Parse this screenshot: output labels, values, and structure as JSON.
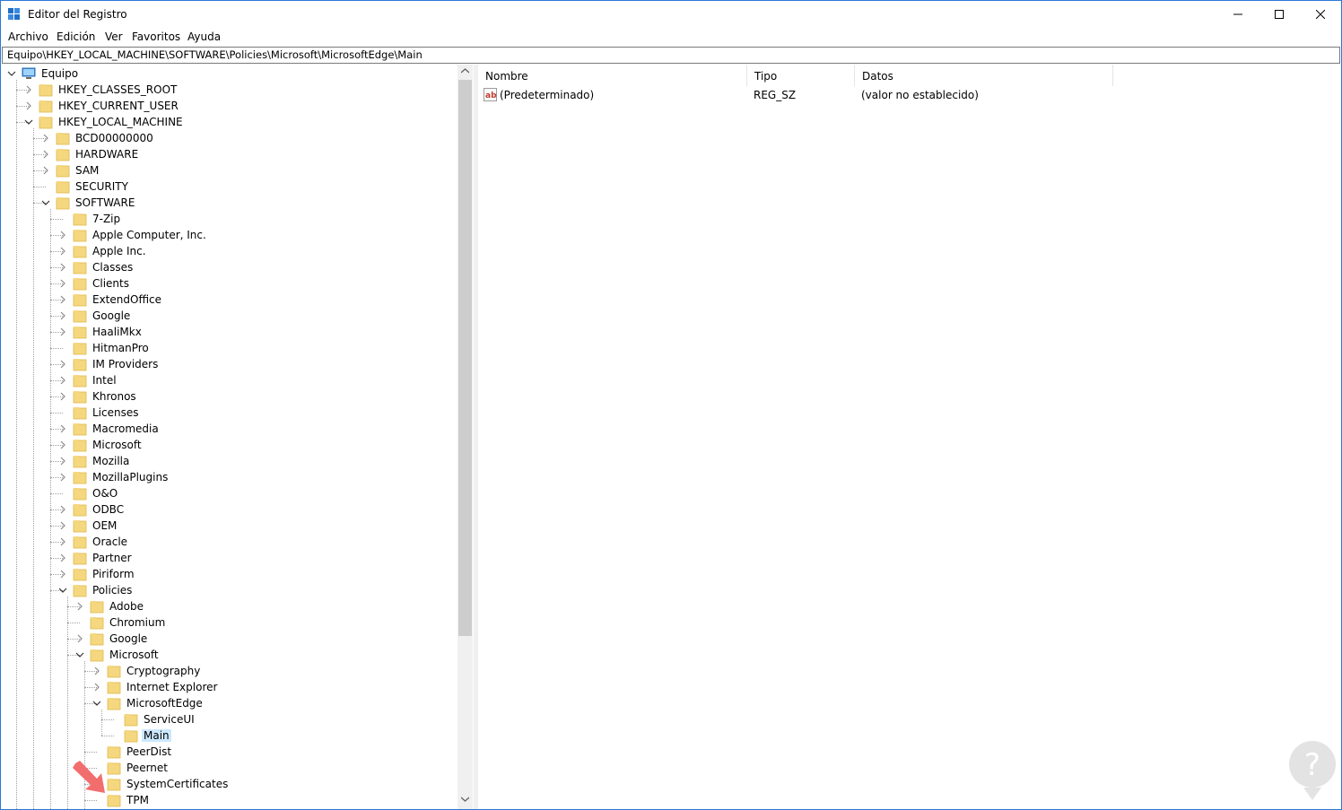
{
  "window": {
    "title": "Editor del Registro",
    "controls": [
      "minimize",
      "maximize",
      "close"
    ]
  },
  "menu": [
    "Archivo",
    "Edición",
    "Ver",
    "Favoritos",
    "Ayuda"
  ],
  "address": "Equipo\\HKEY_LOCAL_MACHINE\\SOFTWARE\\Policies\\Microsoft\\MicrosoftEdge\\Main",
  "tree": [
    {
      "label": "Equipo",
      "level": 0,
      "expander": "down",
      "icon": "computer-icon"
    },
    {
      "label": "HKEY_CLASSES_ROOT",
      "level": 1,
      "expander": "right"
    },
    {
      "label": "HKEY_CURRENT_USER",
      "level": 1,
      "expander": "right"
    },
    {
      "label": "HKEY_LOCAL_MACHINE",
      "level": 1,
      "expander": "down"
    },
    {
      "label": "BCD00000000",
      "level": 2,
      "expander": "right"
    },
    {
      "label": "HARDWARE",
      "level": 2,
      "expander": "right"
    },
    {
      "label": "SAM",
      "level": 2,
      "expander": "right"
    },
    {
      "label": "SECURITY",
      "level": 2,
      "expander": "none"
    },
    {
      "label": "SOFTWARE",
      "level": 2,
      "expander": "down"
    },
    {
      "label": "7-Zip",
      "level": 3,
      "expander": "none"
    },
    {
      "label": "Apple Computer, Inc.",
      "level": 3,
      "expander": "right"
    },
    {
      "label": "Apple Inc.",
      "level": 3,
      "expander": "right"
    },
    {
      "label": "Classes",
      "level": 3,
      "expander": "right"
    },
    {
      "label": "Clients",
      "level": 3,
      "expander": "right"
    },
    {
      "label": "ExtendOffice",
      "level": 3,
      "expander": "right"
    },
    {
      "label": "Google",
      "level": 3,
      "expander": "right"
    },
    {
      "label": "HaaliMkx",
      "level": 3,
      "expander": "right"
    },
    {
      "label": "HitmanPro",
      "level": 3,
      "expander": "none"
    },
    {
      "label": "IM Providers",
      "level": 3,
      "expander": "right"
    },
    {
      "label": "Intel",
      "level": 3,
      "expander": "right"
    },
    {
      "label": "Khronos",
      "level": 3,
      "expander": "right"
    },
    {
      "label": "Licenses",
      "level": 3,
      "expander": "none"
    },
    {
      "label": "Macromedia",
      "level": 3,
      "expander": "right"
    },
    {
      "label": "Microsoft",
      "level": 3,
      "expander": "right"
    },
    {
      "label": "Mozilla",
      "level": 3,
      "expander": "right"
    },
    {
      "label": "MozillaPlugins",
      "level": 3,
      "expander": "right"
    },
    {
      "label": "O&O",
      "level": 3,
      "expander": "none"
    },
    {
      "label": "ODBC",
      "level": 3,
      "expander": "right"
    },
    {
      "label": "OEM",
      "level": 3,
      "expander": "right"
    },
    {
      "label": "Oracle",
      "level": 3,
      "expander": "right"
    },
    {
      "label": "Partner",
      "level": 3,
      "expander": "right"
    },
    {
      "label": "Piriform",
      "level": 3,
      "expander": "right"
    },
    {
      "label": "Policies",
      "level": 3,
      "expander": "down"
    },
    {
      "label": "Adobe",
      "level": 4,
      "expander": "right"
    },
    {
      "label": "Chromium",
      "level": 4,
      "expander": "none"
    },
    {
      "label": "Google",
      "level": 4,
      "expander": "right"
    },
    {
      "label": "Microsoft",
      "level": 4,
      "expander": "down"
    },
    {
      "label": "Cryptography",
      "level": 5,
      "expander": "right"
    },
    {
      "label": "Internet Explorer",
      "level": 5,
      "expander": "right"
    },
    {
      "label": "MicrosoftEdge",
      "level": 5,
      "expander": "down"
    },
    {
      "label": "ServiceUI",
      "level": 6,
      "expander": "none"
    },
    {
      "label": "Main",
      "level": 6,
      "expander": "none",
      "selected": true
    },
    {
      "label": "PeerDist",
      "level": 5,
      "expander": "none"
    },
    {
      "label": "Peernet",
      "level": 5,
      "expander": "none"
    },
    {
      "label": "SystemCertificates",
      "level": 5,
      "expander": "right"
    },
    {
      "label": "TPM",
      "level": 5,
      "expander": "none"
    }
  ],
  "list": {
    "columns": [
      "Nombre",
      "Tipo",
      "Datos"
    ],
    "rows": [
      {
        "name": "(Predeterminado)",
        "type": "REG_SZ",
        "data": "(valor no establecido)",
        "icon": "string-value-icon"
      }
    ]
  },
  "colors": {
    "selection": "#cce8ff",
    "folder": "#f5d77f",
    "arrow": "#f26d6d",
    "window_border": "#2b79d6",
    "logo": "#d9d9d9"
  }
}
